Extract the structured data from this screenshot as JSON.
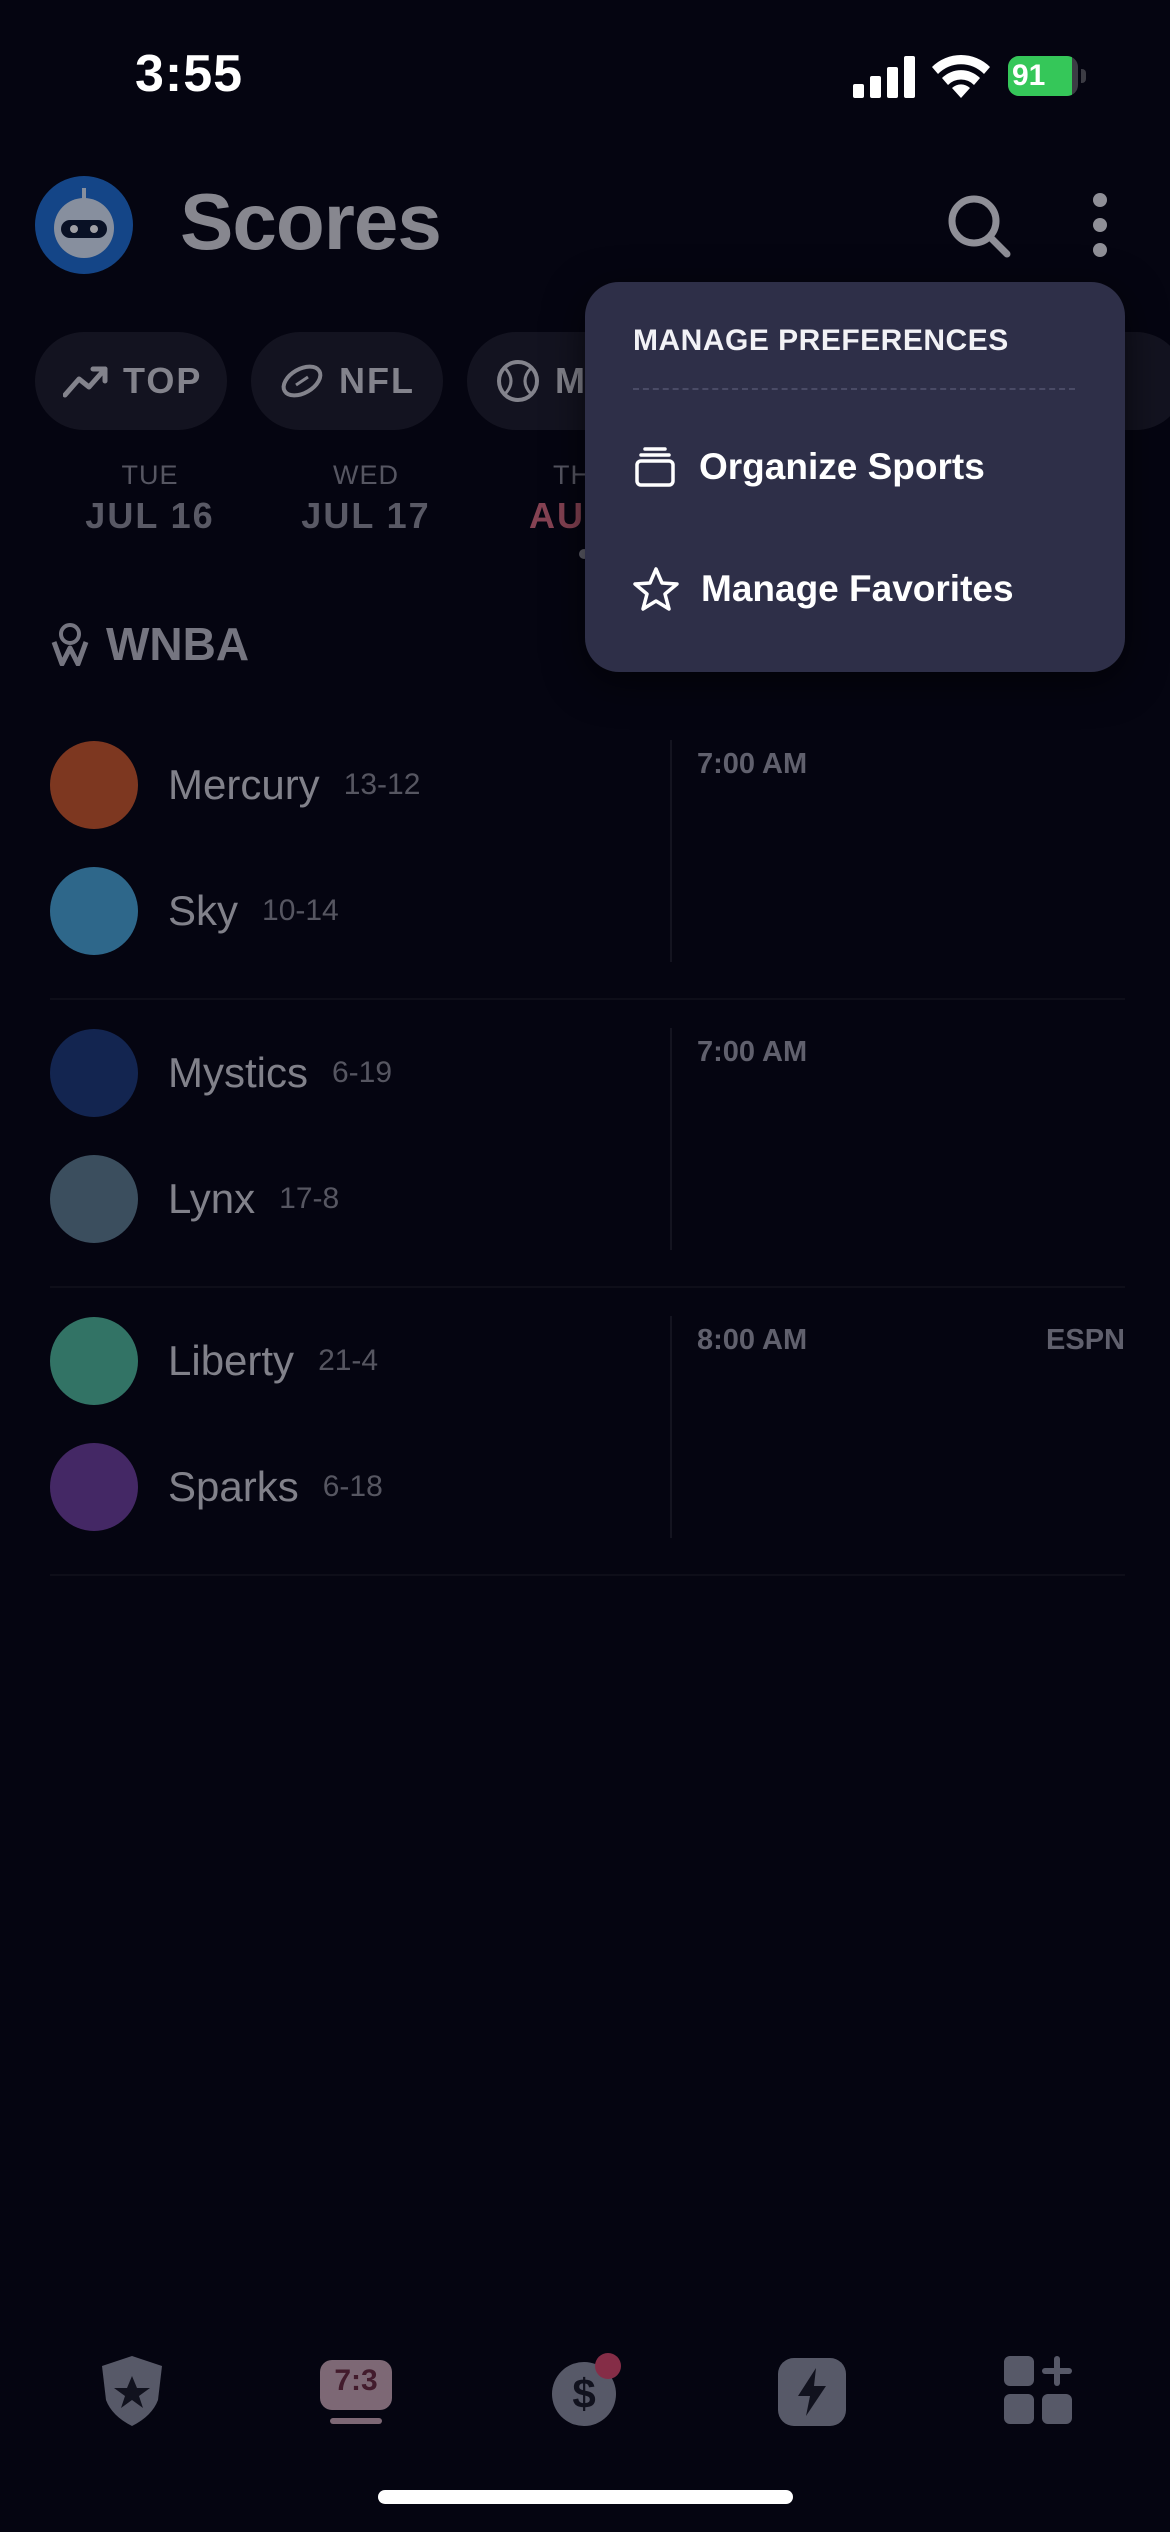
{
  "status_bar": {
    "time": "3:55",
    "battery": "91",
    "battery_level": 0.91
  },
  "header": {
    "title": "Scores"
  },
  "chips": [
    {
      "label": "TOP",
      "icon": "trending-up-icon"
    },
    {
      "label": "NFL",
      "icon": "football-icon"
    },
    {
      "label": "M",
      "icon": "tennis-ball-icon"
    }
  ],
  "dates": [
    {
      "dow": "TUE",
      "day": "JUL 16"
    },
    {
      "dow": "WED",
      "day": "JUL 17"
    },
    {
      "dow": "TH",
      "day": "AUG",
      "selected": true
    }
  ],
  "league": {
    "name": "WNBA"
  },
  "games": [
    {
      "home": {
        "name": "Mercury",
        "record": "13-12",
        "color": "#c9582b"
      },
      "away": {
        "name": "Sky",
        "record": "10-14",
        "color": "#4aa5d6"
      },
      "time": "7:00 AM",
      "network": ""
    },
    {
      "home": {
        "name": "Mystics",
        "record": "6-19",
        "color": "#1e3a78"
      },
      "away": {
        "name": "Lynx",
        "record": "17-8",
        "color": "#5e7d8f"
      },
      "time": "7:00 AM",
      "network": ""
    },
    {
      "home": {
        "name": "Liberty",
        "record": "21-4",
        "color": "#4fb89a"
      },
      "away": {
        "name": "Sparks",
        "record": "6-18",
        "color": "#6d3f9a"
      },
      "time": "8:00 AM",
      "network": "ESPN"
    }
  ],
  "menu": {
    "header": "MANAGE PREFERENCES",
    "items": [
      {
        "label": "Organize Sports",
        "icon": "stack-icon"
      },
      {
        "label": "Manage Favorites",
        "icon": "star-icon"
      }
    ]
  },
  "bottom_nav": {
    "scores_label": "7:3",
    "items": [
      "favorites-shield-icon",
      "scores-icon",
      "dollar-icon",
      "bolt-icon",
      "apps-grid-icon"
    ]
  },
  "colors": {
    "accent": "#d6486a",
    "menu_bg": "#2e2f48",
    "background": "#050511"
  }
}
